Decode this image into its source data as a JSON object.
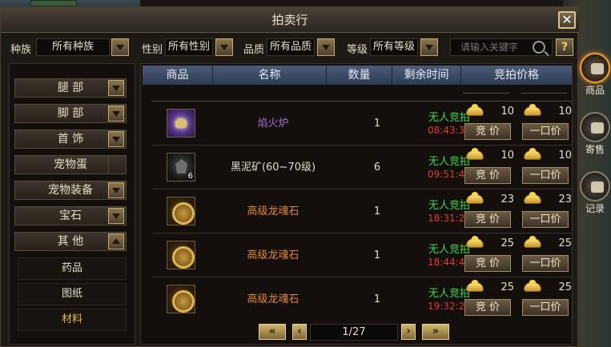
{
  "window": {
    "title": "拍卖行"
  },
  "filters": {
    "race_label": "种族",
    "race_value": "所有种族",
    "gender_label": "性别",
    "gender_value": "所有性别",
    "quality_label": "品质",
    "quality_value": "所有品质",
    "level_label": "等级",
    "level_value": "所有等级",
    "search_placeholder": "请输入关键字",
    "help": "?"
  },
  "categories": [
    {
      "label": "腿 部",
      "expanded": false
    },
    {
      "label": "脚 部",
      "expanded": false
    },
    {
      "label": "首 饰",
      "expanded": false
    },
    {
      "label": "宠物蛋",
      "expanded": false
    },
    {
      "label": "宠物装备",
      "expanded": false
    },
    {
      "label": "宝石",
      "expanded": false
    },
    {
      "label": "其 他",
      "expanded": true
    }
  ],
  "subcategories": [
    {
      "label": "药品",
      "active": false
    },
    {
      "label": "图纸",
      "active": false
    },
    {
      "label": "材料",
      "active": true
    }
  ],
  "table": {
    "headers": {
      "item": "商品",
      "name": "名称",
      "qty": "数量",
      "time": "剩余时间",
      "price": "竞拍价格"
    },
    "rows": [
      {
        "icon": "lamp-icon",
        "stack": "",
        "name": "焰火炉",
        "name_color": "#a86ad8",
        "qty": "1",
        "status": "无人竞拍",
        "time": "08:43:37",
        "bid": "10",
        "buyout": "10",
        "bid_label": "竞 价",
        "buyout_label": "一口价"
      },
      {
        "icon": "ore-icon",
        "stack": "6",
        "name": "黑泥矿(60~70级)",
        "name_color": "#e6dcc6",
        "qty": "6",
        "status": "无人竞拍",
        "time": "09:51:49",
        "bid": "10",
        "buyout": "10",
        "bid_label": "竞 价",
        "buyout_label": "一口价"
      },
      {
        "icon": "dragon-soul-stone-icon",
        "stack": "",
        "name": "高级龙魂石",
        "name_color": "#e08a30",
        "qty": "1",
        "status": "无人竞拍",
        "time": "18:31:29",
        "bid": "23",
        "buyout": "23",
        "bid_label": "竞 价",
        "buyout_label": "一口价"
      },
      {
        "icon": "dragon-soul-stone-icon",
        "stack": "",
        "name": "高级龙魂石",
        "name_color": "#e08a30",
        "qty": "1",
        "status": "无人竞拍",
        "time": "18:44:46",
        "bid": "25",
        "buyout": "25",
        "bid_label": "竞 价",
        "buyout_label": "一口价"
      },
      {
        "icon": "dragon-soul-stone-icon",
        "stack": "",
        "name": "高级龙魂石",
        "name_color": "#e08a30",
        "qty": "1",
        "status": "无人竞拍",
        "time": "19:32:27",
        "bid": "25",
        "buyout": "25",
        "bid_label": "竞 价",
        "buyout_label": "一口价"
      }
    ]
  },
  "pager": {
    "first": "«",
    "prev": "‹",
    "info": "1/27",
    "next": "›",
    "last": "»"
  },
  "side_tabs": [
    {
      "label": "商品",
      "icon": "teapot-icon",
      "active": true
    },
    {
      "label": "寄售",
      "icon": "bag-icon",
      "active": false
    },
    {
      "label": "记录",
      "icon": "scroll-icon",
      "active": false
    }
  ],
  "colors": {
    "status_green": "#44d24a",
    "timer_red": "#e03c2c",
    "accent_gold": "#e8b84a"
  }
}
